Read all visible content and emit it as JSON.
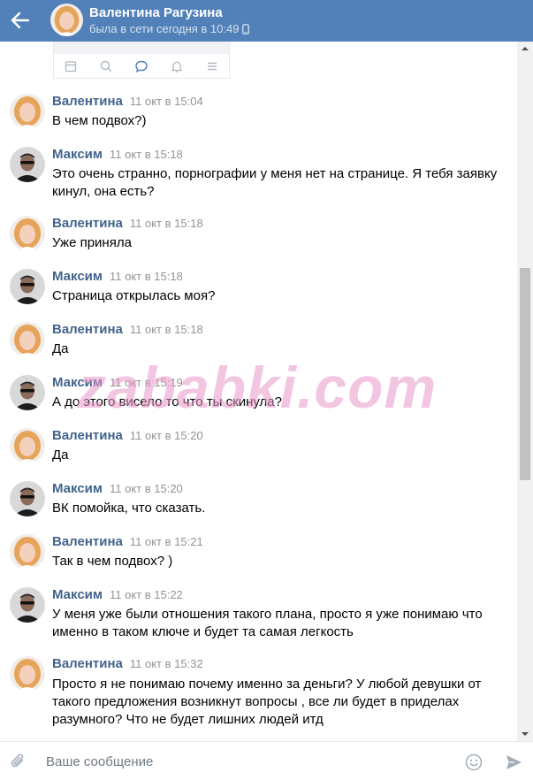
{
  "header": {
    "name": "Валентина Рагузина",
    "status": "была в сети сегодня в 10:49",
    "status_icon": "phone-icon",
    "background": "#5181b8"
  },
  "messages": [
    {
      "author": "Валентина",
      "time": "11 окт в 15:04",
      "text": "В чем подвох?)"
    },
    {
      "author": "Максим",
      "time": "11 окт в 15:18",
      "text": "Это очень странно, порнографии у меня нет на странице. Я тебя заявку кинул, она есть?"
    },
    {
      "author": "Валентина",
      "time": "11 окт в 15:18",
      "text": "Уже приняла"
    },
    {
      "author": "Максим",
      "time": "11 окт в 15:18",
      "text": "Страница открылась моя?"
    },
    {
      "author": "Валентина",
      "time": "11 окт в 15:18",
      "text": "Да"
    },
    {
      "author": "Максим",
      "time": "11 окт в 15:19",
      "text": "А до этого висело то что ты скинула?"
    },
    {
      "author": "Валентина",
      "time": "11 окт в 15:20",
      "text": "Да"
    },
    {
      "author": "Максим",
      "time": "11 окт в 15:20",
      "text": "ВК помойка, что сказать."
    },
    {
      "author": "Валентина",
      "time": "11 окт в 15:21",
      "text": "Так в чем подвох? )"
    },
    {
      "author": "Максим",
      "time": "11 окт в 15:22",
      "text": "У меня уже были отношения такого плана, просто я уже понимаю что именно в таком ключе и будет та самая легкость"
    },
    {
      "author": "Валентина",
      "time": "11 окт в 15:32",
      "text": "Просто я не понимаю почему именно за деньги? У любой девушки от такого предложения возникнут вопросы , все ли будет в приделах разумного? Что не будет лишних людей итд"
    }
  ],
  "watermark": "zababki.com",
  "composer": {
    "placeholder": "Ваше сообщение"
  },
  "colors": {
    "author": "#42648b",
    "time": "#939393",
    "accent": "#5181b8"
  }
}
